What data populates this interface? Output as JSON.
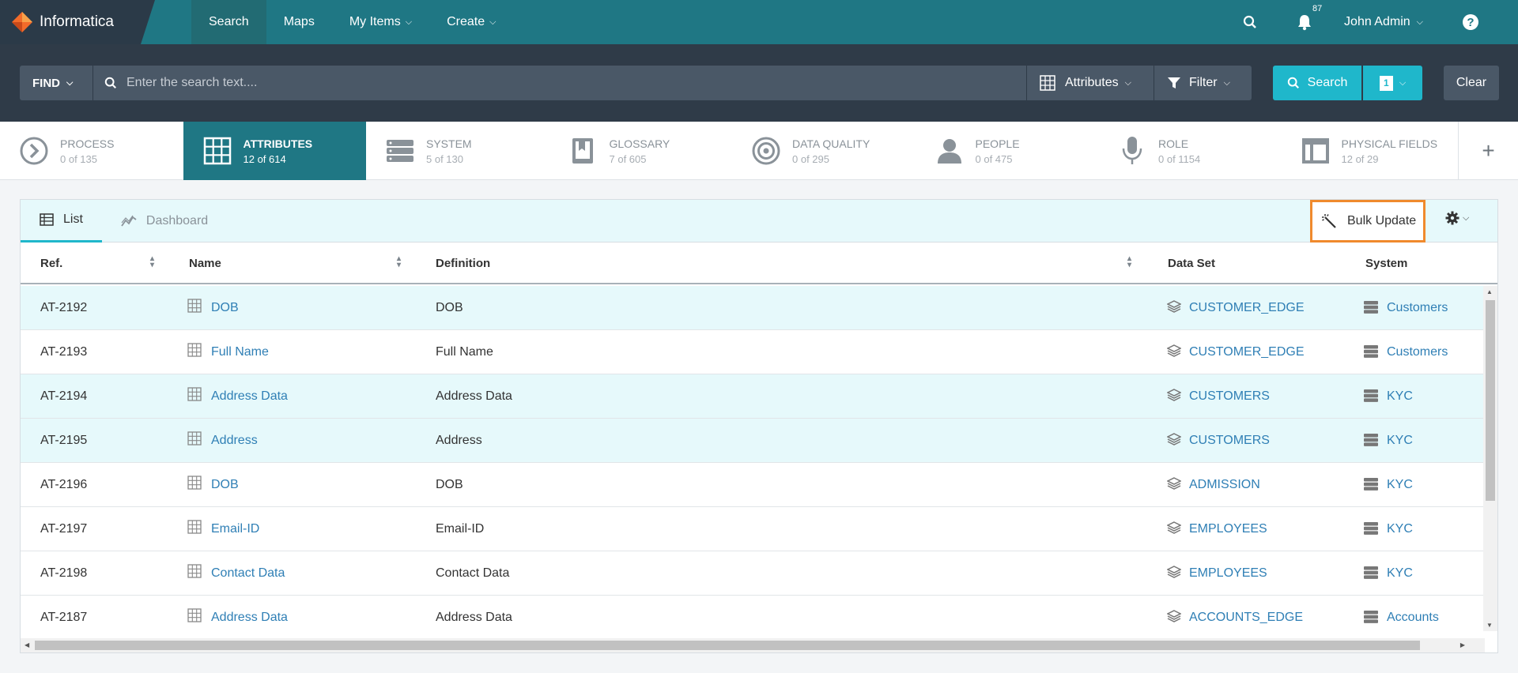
{
  "app": {
    "name": "Informatica"
  },
  "nav": {
    "items": [
      {
        "label": "Search",
        "active": true,
        "dropdown": false
      },
      {
        "label": "Maps",
        "active": false,
        "dropdown": false
      },
      {
        "label": "My Items",
        "active": false,
        "dropdown": true
      },
      {
        "label": "Create",
        "active": false,
        "dropdown": true
      }
    ],
    "notification_count": "87",
    "user": "John Admin"
  },
  "searchbar": {
    "find_label": "FIND",
    "placeholder": "Enter the search text....",
    "attributes_label": "Attributes",
    "filter_label": "Filter",
    "search_label": "Search",
    "count": "1",
    "clear_label": "Clear"
  },
  "categories": [
    {
      "name": "PROCESS",
      "count": "0 of 135",
      "icon": "process-icon",
      "active": false
    },
    {
      "name": "ATTRIBUTES",
      "count": "12 of 614",
      "icon": "grid-icon",
      "active": true
    },
    {
      "name": "SYSTEM",
      "count": "5 of 130",
      "icon": "server-icon",
      "active": false
    },
    {
      "name": "GLOSSARY",
      "count": "7 of 605",
      "icon": "book-icon",
      "active": false
    },
    {
      "name": "DATA QUALITY",
      "count": "0 of 295",
      "icon": "target-icon",
      "active": false
    },
    {
      "name": "PEOPLE",
      "count": "0 of 475",
      "icon": "person-icon",
      "active": false
    },
    {
      "name": "ROLE",
      "count": "0 of 1154",
      "icon": "microphone-icon",
      "active": false
    },
    {
      "name": "PHYSICAL FIELDS",
      "count": "12 of 29",
      "icon": "physical-field-icon",
      "active": false
    }
  ],
  "view_tabs": {
    "list": "List",
    "dashboard": "Dashboard"
  },
  "bulk_update_label": "Bulk Update",
  "columns": {
    "ref": "Ref.",
    "name": "Name",
    "definition": "Definition",
    "dataset": "Data Set",
    "system": "System"
  },
  "rows": [
    {
      "ref": "AT-2192",
      "name": "DOB",
      "definition": "DOB",
      "dataset": "CUSTOMER_EDGE",
      "system": "Customers",
      "highlighted": true
    },
    {
      "ref": "AT-2193",
      "name": "Full Name",
      "definition": "Full Name",
      "dataset": "CUSTOMER_EDGE",
      "system": "Customers",
      "highlighted": false
    },
    {
      "ref": "AT-2194",
      "name": "Address Data",
      "definition": "Address Data",
      "dataset": "CUSTOMERS",
      "system": "KYC",
      "highlighted": true
    },
    {
      "ref": "AT-2195",
      "name": "Address",
      "definition": "Address",
      "dataset": "CUSTOMERS",
      "system": "KYC",
      "highlighted": true
    },
    {
      "ref": "AT-2196",
      "name": "DOB",
      "definition": "DOB",
      "dataset": "ADMISSION",
      "system": "KYC",
      "highlighted": false
    },
    {
      "ref": "AT-2197",
      "name": "Email-ID",
      "definition": "Email-ID",
      "dataset": "EMPLOYEES",
      "system": "KYC",
      "highlighted": false
    },
    {
      "ref": "AT-2198",
      "name": "Contact Data",
      "definition": "Contact Data",
      "dataset": "EMPLOYEES",
      "system": "KYC",
      "highlighted": false
    },
    {
      "ref": "AT-2187",
      "name": "Address Data",
      "definition": "Address Data",
      "dataset": "ACCOUNTS_EDGE",
      "system": "Accounts",
      "highlighted": false
    }
  ],
  "colors": {
    "nav": "#1f7784",
    "accent": "#1fb7cb",
    "highlight": "#f08a2d",
    "link": "#2f7fb5"
  }
}
